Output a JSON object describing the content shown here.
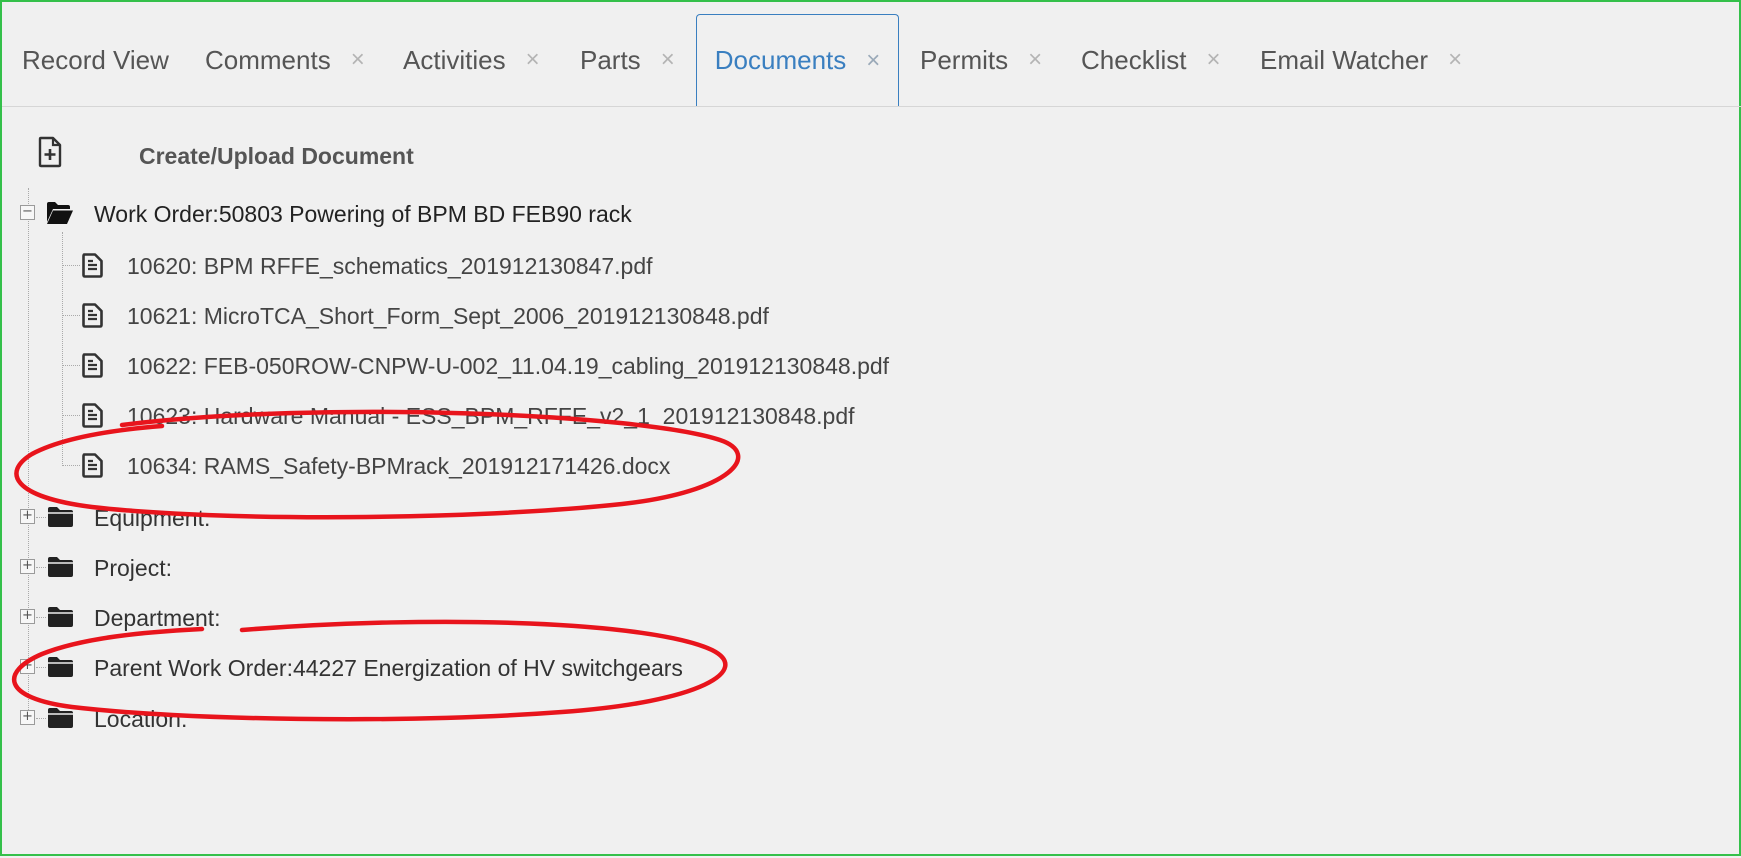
{
  "tabs": [
    {
      "label": "Record View",
      "closable": false,
      "active": false
    },
    {
      "label": "Comments",
      "closable": true,
      "active": false
    },
    {
      "label": "Activities",
      "closable": true,
      "active": false
    },
    {
      "label": "Parts",
      "closable": true,
      "active": false
    },
    {
      "label": "Documents",
      "closable": true,
      "active": true
    },
    {
      "label": "Permits",
      "closable": true,
      "active": false
    },
    {
      "label": "Checklist",
      "closable": true,
      "active": false
    },
    {
      "label": "Email Watcher",
      "closable": true,
      "active": false
    }
  ],
  "close_glyph": "×",
  "create_upload": {
    "label": "Create/Upload Document",
    "icon": "file-plus-icon"
  },
  "tree": {
    "work_order": {
      "label": "Work Order:50803 Powering of BPM BD FEB90 rack",
      "expanded": true,
      "documents": [
        "10620: BPM RFFE_schematics_201912130847.pdf",
        "10621: MicroTCA_Short_Form_Sept_2006_201912130848.pdf",
        "10622: FEB-050ROW-CNPW-U-002_11.04.19_cabling_201912130848.pdf",
        "10623: Hardware Manual - ESS_BPM_RFFE_v2_1_201912130848.pdf",
        "10634: RAMS_Safety-BPMrack_201912171426.docx"
      ]
    },
    "collapsed_folders": [
      "Equipment:",
      "Project:",
      "Department:",
      "Parent Work Order:44227 Energization of HV switchgears",
      "Location:"
    ],
    "expand_glyph": "+",
    "collapse_glyph": "−"
  },
  "colors": {
    "frame_border": "#34c04a",
    "active_tab": "#3a7fc0",
    "annotation": "#e8141c",
    "background": "#f0f0f0"
  }
}
